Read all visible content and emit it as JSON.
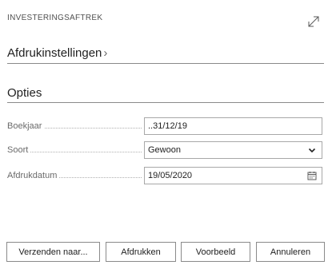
{
  "dialog": {
    "title": "INVESTERINGSAFTREK"
  },
  "sections": {
    "print_settings": "Afdrukinstellingen",
    "print_settings_chevron": "›",
    "options": "Opties"
  },
  "fields": {
    "boekjaar": {
      "label": "Boekjaar",
      "value": "..31/12/19"
    },
    "soort": {
      "label": "Soort",
      "value": "Gewoon"
    },
    "afdrukdatum": {
      "label": "Afdrukdatum",
      "value": "19/05/2020"
    }
  },
  "buttons": {
    "send_to": "Verzenden naar...",
    "print": "Afdrukken",
    "preview": "Voorbeeld",
    "cancel": "Annuleren"
  },
  "icons": {
    "expand": "expand-diagonal-icon",
    "dropdown": "chevron-down-icon",
    "calendar": "calendar-icon"
  }
}
